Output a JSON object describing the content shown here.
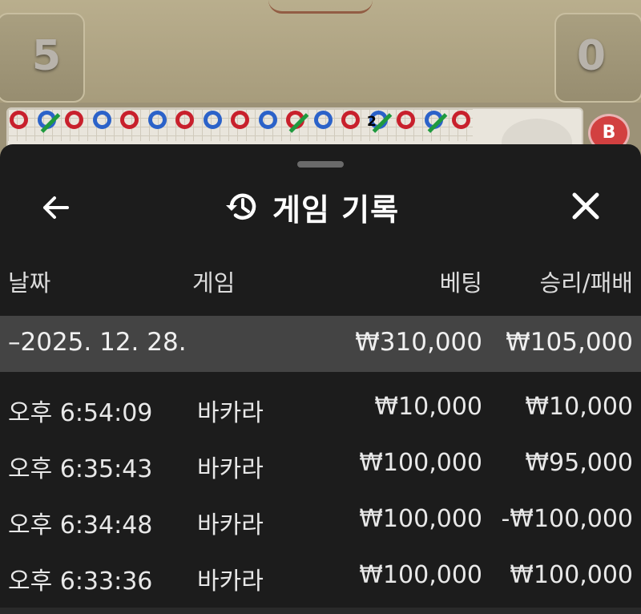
{
  "background": {
    "score_left": "5",
    "score_right": "0",
    "road_badge": "2",
    "banker_button": "B",
    "beads": [
      {
        "color": "red",
        "slash": false
      },
      {
        "color": "blue",
        "slash": true
      },
      {
        "color": "red",
        "slash": false
      },
      {
        "color": "blue",
        "slash": false
      },
      {
        "color": "red",
        "slash": false
      },
      {
        "color": "blue",
        "slash": false
      },
      {
        "color": "red",
        "slash": false
      },
      {
        "color": "blue",
        "slash": false
      },
      {
        "color": "red",
        "slash": false
      },
      {
        "color": "blue",
        "slash": false
      },
      {
        "color": "red",
        "slash": true
      },
      {
        "color": "blue",
        "slash": false
      },
      {
        "color": "red",
        "slash": false
      },
      {
        "color": "blue",
        "slash": true
      },
      {
        "color": "red",
        "slash": false
      },
      {
        "color": "blue",
        "slash": true
      },
      {
        "color": "red",
        "slash": false
      }
    ]
  },
  "panel": {
    "title": "게임 기록",
    "back_icon": "arrow-left-icon",
    "history_icon": "history-icon",
    "close_icon": "close-icon"
  },
  "table": {
    "headers": {
      "date": "날짜",
      "game": "게임",
      "bet": "베팅",
      "result": "승리/패배"
    },
    "date_group": {
      "prefix": "–",
      "date": "2025. 12. 28.",
      "bet_total": "₩310,000",
      "result_total": "₩105,000"
    },
    "rows": [
      {
        "time": "오후 6:54:09",
        "game": "바카라",
        "bet": "₩10,000",
        "result": "₩10,000"
      },
      {
        "time": "오후 6:35:43",
        "game": "바카라",
        "bet": "₩100,000",
        "result": "₩95,000"
      },
      {
        "time": "오후 6:34:48",
        "game": "바카라",
        "bet": "₩100,000",
        "result": "-₩100,000"
      },
      {
        "time": "오후 6:33:36",
        "game": "바카라",
        "bet": "₩100,000",
        "result": "₩100,000"
      }
    ]
  },
  "colors": {
    "panel_bg": "#1c1c1c",
    "date_row_bg": "#444444",
    "banker_red": "#d24040",
    "player_blue": "#2b62c9"
  }
}
